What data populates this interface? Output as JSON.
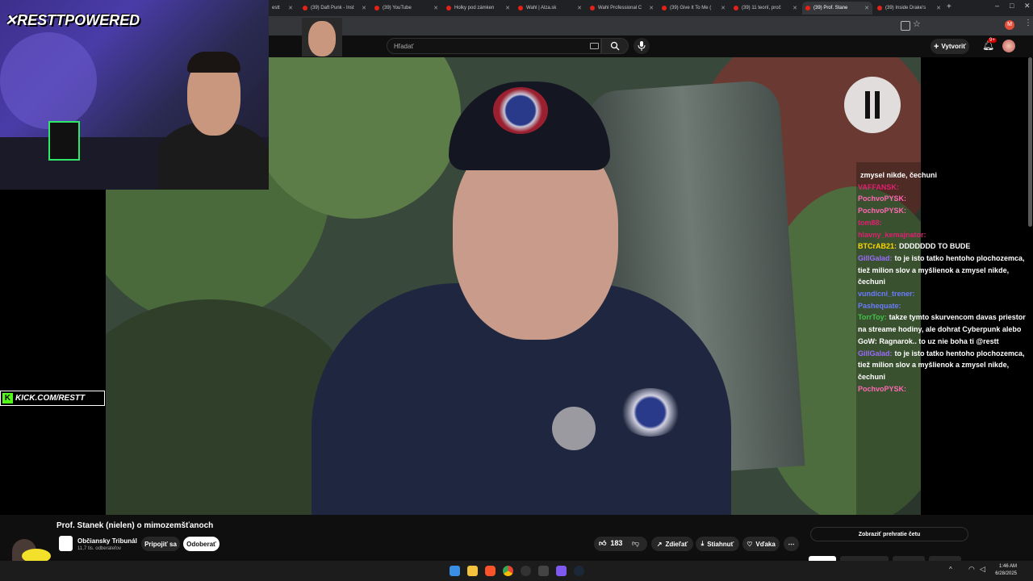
{
  "browser": {
    "tabs": [
      {
        "label": "estt",
        "active": false
      },
      {
        "label": "(39) Daft Punk - Inst",
        "active": false
      },
      {
        "label": "(39) YouTube",
        "active": false
      },
      {
        "label": "Holky pod zámken",
        "active": false
      },
      {
        "label": "Wahl | Alza.sk",
        "active": false
      },
      {
        "label": "Wahl Professional C",
        "active": false
      },
      {
        "label": "(39) Give It To Me (",
        "active": false
      },
      {
        "label": "(39) 11 teorií, proč",
        "active": false
      },
      {
        "label": "(39) Prof. Stane",
        "active": true
      },
      {
        "label": "(39) Inside Drake's",
        "active": false
      }
    ]
  },
  "youtube": {
    "search_placeholder": "Hľadať",
    "create_label": "Vytvoriť",
    "notif_count": "9+",
    "avatar_letter": "M"
  },
  "stream_overlay": {
    "logo_text": "RESTTPOWERED",
    "kick_text": "KICK.COM/RESTT"
  },
  "chat": {
    "messages": [
      {
        "user": "",
        "text": "zmysel nikde, čechuni",
        "color": "#ffffff"
      },
      {
        "user": "VAFFANSK:",
        "text": "",
        "color": "#e02070"
      },
      {
        "user": "PochvoPYSK:",
        "text": "",
        "color": "#ff69b4"
      },
      {
        "user": "PochvoPYSK:",
        "text": "",
        "color": "#ff69b4"
      },
      {
        "user": "tom88:",
        "text": "",
        "color": "#e02070"
      },
      {
        "user": "hlavny_kemajnator:",
        "text": "",
        "color": "#e02070"
      },
      {
        "user": "BTCrAB21:",
        "text": "DDDDDDD TO BUDE",
        "color": "#ffd700"
      },
      {
        "user": "GillGalad:",
        "text": "to je isto tatko hentoho plochozemca, tiež milion slov a myšlienok a zmysel nikde, čechuni",
        "color": "#9b6cff"
      },
      {
        "user": "vundicni_trener:",
        "text": "",
        "color": "#6b7bff"
      },
      {
        "user": "Pashequate:",
        "text": "",
        "color": "#6b7bff"
      },
      {
        "user": "TorrToy:",
        "text": "takze tymto skurvencom davas priestor na streame hodiny, ale dohrat Cyberpunk alebo GoW: Ragnarok.. to uz nie boha ti @restt",
        "color": "#42c24a"
      },
      {
        "user": "GillGalad:",
        "text": "to je isto tatko hentoho plochozemca, tiež milion slov a myšlienok a zmysel nikde, čechuni",
        "color": "#9b6cff"
      },
      {
        "user": "PochvoPYSK:",
        "text": "",
        "color": "#ff69b4"
      }
    ]
  },
  "video_info": {
    "title": "Prof. Stanek (nielen) o mimozemšťanoch",
    "channel": "Občiansky Tribunál",
    "subscribers": "11,7 tis. odberateľov",
    "join_label": "Pripojiť sa",
    "subscribe_label": "Odoberať",
    "likes": "183",
    "share_label": "Zdieľať",
    "download_label": "Stiahnuť",
    "thanks_label": "Vďaka",
    "chat_replay_label": "Zobraziť prehratie četu"
  },
  "clock": {
    "time": "1:46 AM",
    "date": "6/28/2025"
  }
}
